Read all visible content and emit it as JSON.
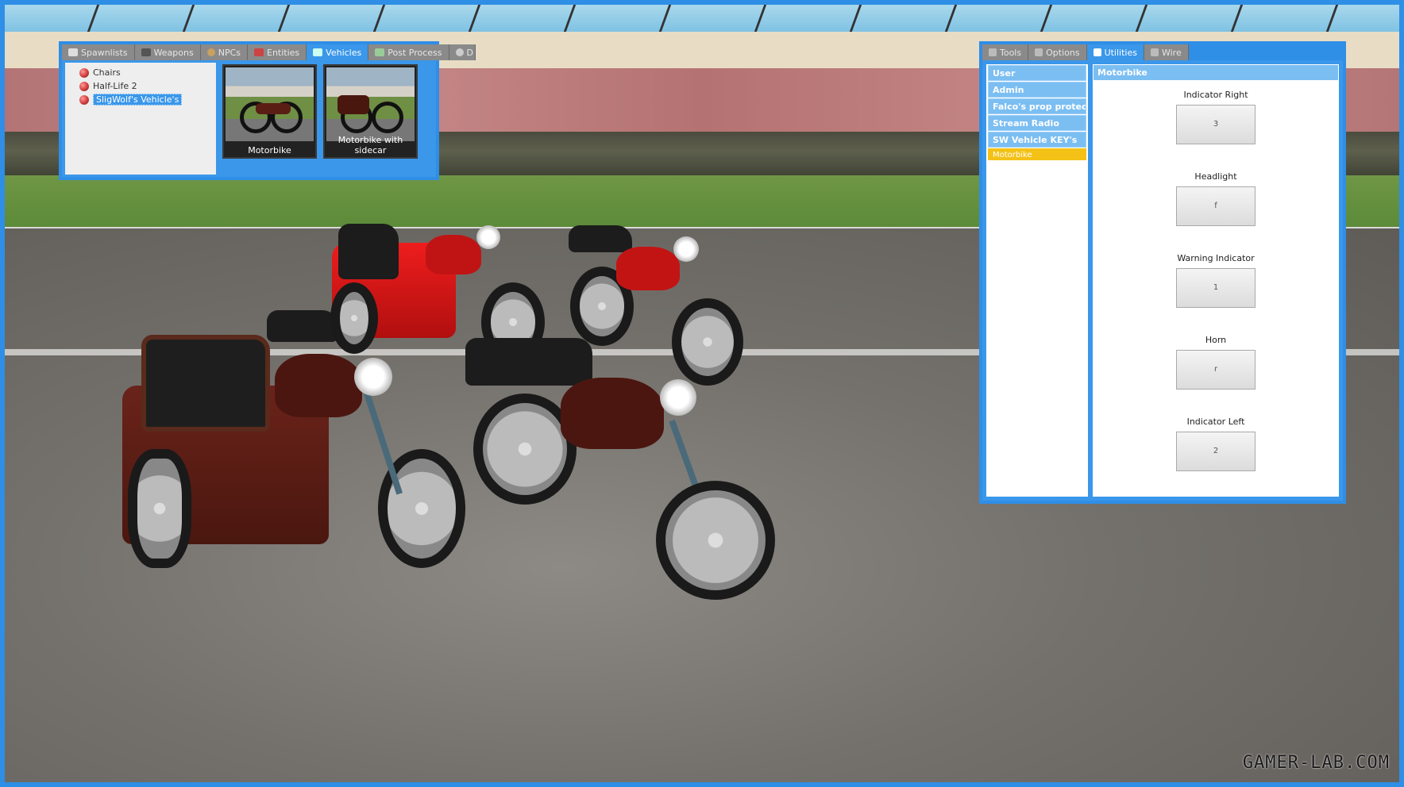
{
  "spawnmenu": {
    "tabs": [
      {
        "label": "Spawnlists",
        "icon": "spawnlist-icon"
      },
      {
        "label": "Weapons",
        "icon": "weapon-icon"
      },
      {
        "label": "NPCs",
        "icon": "npc-icon"
      },
      {
        "label": "Entities",
        "icon": "entity-icon"
      },
      {
        "label": "Vehicles",
        "icon": "car-icon",
        "active": true
      },
      {
        "label": "Post Process",
        "icon": "postprocess-icon"
      },
      {
        "label": "D",
        "icon": "dupes-icon"
      }
    ],
    "tree": [
      {
        "label": "Chairs"
      },
      {
        "label": "Half-Life 2"
      },
      {
        "label": "SligWolf's Vehicle's",
        "selected": true
      }
    ],
    "items": [
      {
        "label": "Motorbike"
      },
      {
        "label": "Motorbike with sidecar"
      }
    ]
  },
  "contextmenu": {
    "tabs": [
      {
        "label": "Tools",
        "icon": "wrench-icon"
      },
      {
        "label": "Options",
        "icon": "wrench-icon"
      },
      {
        "label": "Utilities",
        "icon": "page-icon",
        "active": true
      },
      {
        "label": "Wire",
        "icon": "wrench-icon"
      }
    ],
    "categories": [
      {
        "label": "User"
      },
      {
        "label": "Admin"
      },
      {
        "label": "Falco's prop protect..."
      },
      {
        "label": "Stream Radio"
      },
      {
        "label": "SW Vehicle KEY's"
      },
      {
        "label": "Motorbike",
        "highlighted": true
      }
    ],
    "settings_title": "Motorbike",
    "keybinds": [
      {
        "label": "Indicator Right",
        "key": "3"
      },
      {
        "label": "Headlight",
        "key": "f"
      },
      {
        "label": "Warning Indicator",
        "key": "1"
      },
      {
        "label": "Horn",
        "key": "r"
      },
      {
        "label": "Indicator Left",
        "key": "2"
      }
    ]
  },
  "watermark": "GAMER-LAB.COM",
  "colors": {
    "accent": "#2f8ee6",
    "category": "#7bbef2",
    "highlight": "#f4c117"
  }
}
